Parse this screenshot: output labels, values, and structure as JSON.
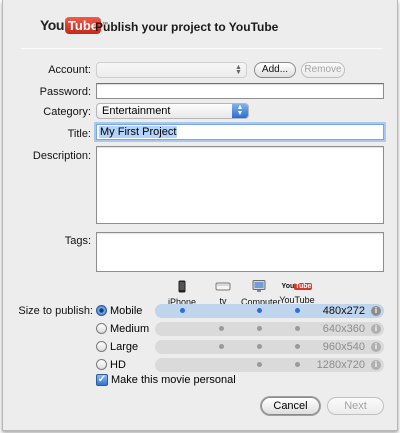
{
  "header": {
    "logo_you": "You",
    "logo_tube": "Tube",
    "logo_tm": "™",
    "title": "Publish your project to YouTube"
  },
  "form": {
    "account_label": "Account:",
    "account_value": "",
    "add_label": "Add...",
    "remove_label": "Remove",
    "password_label": "Password:",
    "password_value": "",
    "category_label": "Category:",
    "category_value": "Entertainment",
    "title_label": "Title:",
    "title_value": "My First Project",
    "description_label": "Description:",
    "description_value": "",
    "tags_label": "Tags:",
    "tags_value": ""
  },
  "size": {
    "label": "Size to publish:",
    "devices": [
      {
        "name": "iPhone",
        "icon": "iphone-icon"
      },
      {
        "name": "tv",
        "icon": "apple-tv-icon"
      },
      {
        "name": "Computer",
        "icon": "computer-icon"
      },
      {
        "name": "YouTube",
        "icon": "youtube-icon"
      }
    ],
    "tv_logo": "",
    "youtube_logo": "You",
    "options": [
      {
        "label": "Mobile",
        "resolution": "480x272",
        "selected": true
      },
      {
        "label": "Medium",
        "resolution": "640x360",
        "selected": false
      },
      {
        "label": "Large",
        "resolution": "960x540",
        "selected": false
      },
      {
        "label": "HD",
        "resolution": "1280x720",
        "selected": false
      }
    ],
    "info_glyph": "i"
  },
  "personal": {
    "label": "Make this movie personal",
    "checked": true,
    "check_glyph": "✓"
  },
  "buttons": {
    "cancel": "Cancel",
    "next": "Next"
  },
  "colors": {
    "accent": "#2c6be0",
    "selected_row": "#bfd5ee",
    "youtube_red": "#d6382a"
  }
}
